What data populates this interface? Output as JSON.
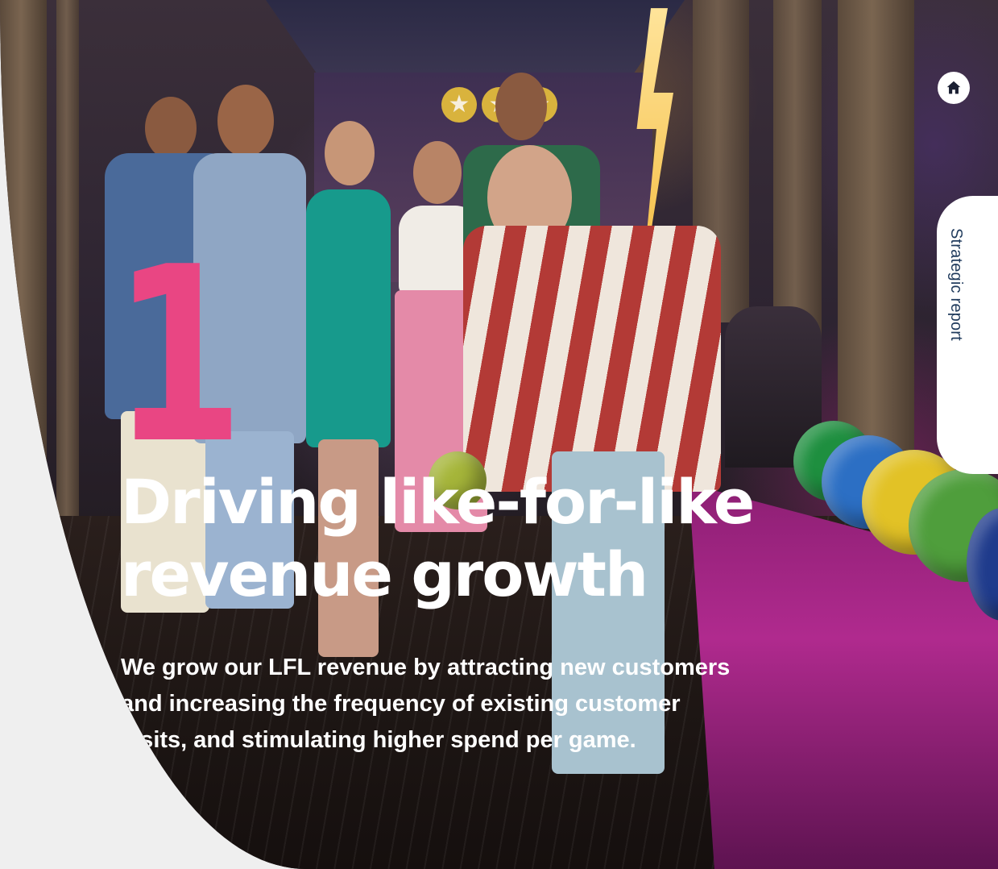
{
  "section_number": "1",
  "headline": {
    "line1": "Driving like-for-like",
    "line2": "revenue growth"
  },
  "subtext": {
    "line1": "We grow our LFL revenue by attracting new customers",
    "line2": "and increasing the frequency of existing customer",
    "line3": "visits, and stimulating higher spend per game."
  },
  "nav": {
    "home_icon": "home-icon",
    "side_tab_label": "Strategic report"
  },
  "colors": {
    "accent_pink": "#e94683",
    "side_tab_text": "#1f3a5c",
    "page_background": "#efefef"
  }
}
